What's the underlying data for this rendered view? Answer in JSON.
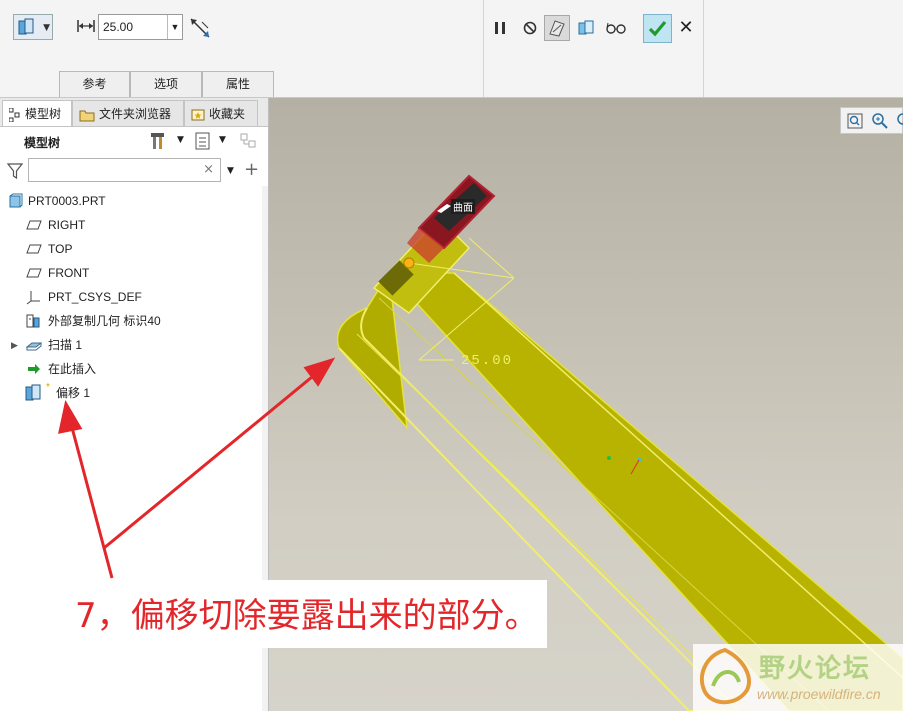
{
  "toolbar": {
    "depth_value": "25.00",
    "icons": [
      "offset-feature-icon",
      "depth-icon",
      "flip-icon",
      "pause-icon",
      "cancel-icon",
      "preview-icon",
      "verify-icon",
      "glasses-icon",
      "ok-check-icon",
      "close-icon"
    ],
    "tabs": [
      {
        "label": "参考"
      },
      {
        "label": "选项"
      },
      {
        "label": "属性"
      }
    ]
  },
  "panel": {
    "tabs": [
      {
        "label": "模型树"
      },
      {
        "label": "文件夹浏览器"
      },
      {
        "label": "收藏夹"
      }
    ],
    "tree_title": "模型树",
    "filter_value": "",
    "items": [
      {
        "label": "PRT0003.PRT",
        "icon": "part-icon"
      },
      {
        "label": "RIGHT",
        "icon": "datum-plane-icon"
      },
      {
        "label": "TOP",
        "icon": "datum-plane-icon"
      },
      {
        "label": "FRONT",
        "icon": "datum-plane-icon"
      },
      {
        "label": "PRT_CSYS_DEF",
        "icon": "csys-icon"
      },
      {
        "label": "外部复制几何 标识40",
        "icon": "external-copy-icon"
      },
      {
        "label": "扫描 1",
        "icon": "sweep-icon"
      },
      {
        "label": "在此插入",
        "icon": "insert-arrow-icon"
      },
      {
        "label": "偏移 1",
        "icon": "offset-feature-icon"
      }
    ]
  },
  "viewport": {
    "dimension_label": "25.00",
    "surface_label": "曲面",
    "model_color": "#c8c400"
  },
  "annotation": {
    "text": "7，偏移切除要露出来的部分。",
    "color": "#e2262a"
  },
  "watermark": {
    "name": "野火论坛",
    "url": "www.proewildfire.cn"
  }
}
